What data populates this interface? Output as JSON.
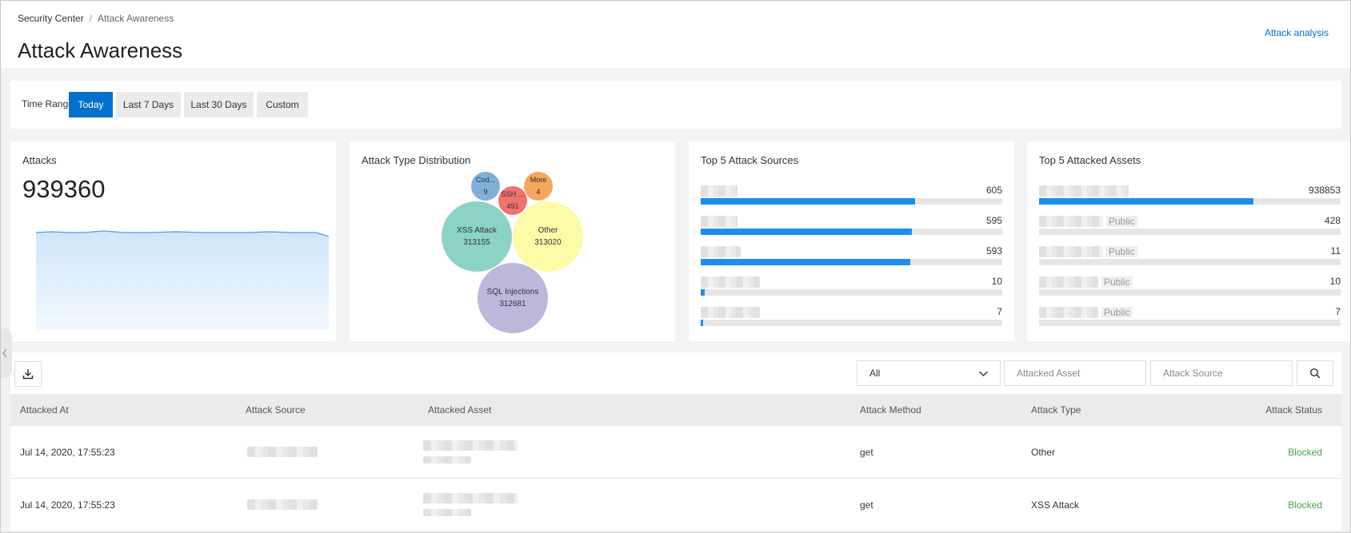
{
  "breadcrumb": {
    "root": "Security Center",
    "separator": "/",
    "current": "Attack Awareness"
  },
  "page_title": "Attack Awareness",
  "header_link": "Attack analysis",
  "time_range": {
    "label": "Time Range:",
    "options": [
      "Today",
      "Last 7 Days",
      "Last 30 Days",
      "Custom"
    ],
    "selected": "Today"
  },
  "attacks_card": {
    "title": "Attacks",
    "total": "939360"
  },
  "distribution_card": {
    "title": "Attack Type Distribution",
    "bubbles": [
      {
        "name": "Cod...",
        "value": "9",
        "color": "#7fb0d8"
      },
      {
        "name": "SSH ...",
        "value": "491",
        "color": "#f0736e"
      },
      {
        "name": "More",
        "value": "4",
        "color": "#f5a85d"
      },
      {
        "name": "XSS Attack",
        "value": "313155",
        "color": "#8cd3c5"
      },
      {
        "name": "Other",
        "value": "313020",
        "color": "#fdfaa8"
      },
      {
        "name": "SQL Injections",
        "value": "312681",
        "color": "#bbb8db"
      }
    ]
  },
  "sources_card": {
    "title": "Top 5 Attack Sources",
    "items": [
      {
        "value": "605",
        "pct": 0.71
      },
      {
        "value": "595",
        "pct": 0.7
      },
      {
        "value": "593",
        "pct": 0.695
      },
      {
        "value": "10",
        "pct": 0.012
      },
      {
        "value": "7",
        "pct": 0.008
      }
    ]
  },
  "assets_card": {
    "title": "Top 5 Attacked Assets",
    "items": [
      {
        "tag": "",
        "value": "938853",
        "pct": 0.71
      },
      {
        "tag": "Public",
        "value": "428",
        "pct": 0
      },
      {
        "tag": "Public",
        "value": "11",
        "pct": 0
      },
      {
        "tag": "Public",
        "value": "10",
        "pct": 0
      },
      {
        "tag": "Public",
        "value": "7",
        "pct": 0
      }
    ]
  },
  "filters": {
    "type_select": "All",
    "asset_placeholder": "Attacked Asset",
    "source_placeholder": "Attack Source"
  },
  "table": {
    "columns": [
      "Attacked At",
      "Attack Source",
      "Attacked Asset",
      "Attack Method",
      "Attack Type",
      "Attack Status"
    ],
    "rows": [
      {
        "time": "Jul 14, 2020, 17:55:23",
        "method": "get",
        "type": "Other",
        "status": "Blocked"
      },
      {
        "time": "Jul 14, 2020, 17:55:23",
        "method": "get",
        "type": "XSS Attack",
        "status": "Blocked"
      }
    ]
  },
  "colors": {
    "accent": "#0070cc",
    "bar": "#1f8cf0",
    "blocked": "#3da43d"
  },
  "icons": {
    "download": "download-icon",
    "search": "search-icon",
    "select": "chevron-down-icon",
    "collapse": "chevron-left-icon"
  }
}
